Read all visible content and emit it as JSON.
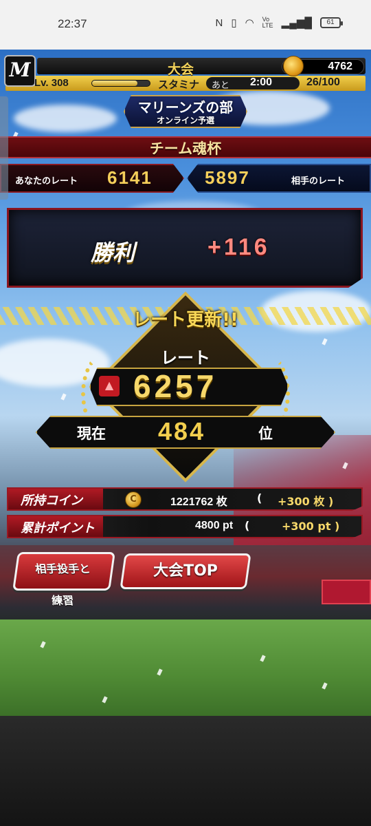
{
  "status_bar": {
    "time": "22:37",
    "nfc": "N",
    "volte": "Vo LTE",
    "battery": "61"
  },
  "header": {
    "menu_logo": "M",
    "title": "大会",
    "currency": "4762",
    "level_label": "Lv.",
    "level_value": "308",
    "level_progress": 0.78,
    "stamina_label": "スタミナ",
    "remaining_label": "あと",
    "timer": "2:00",
    "stamina_value": "26/100"
  },
  "event": {
    "title": "マリーンズの部",
    "subtitle": "オンライン予選",
    "cup_name": "チーム魂杯"
  },
  "rates": {
    "my_label": "あなたのレート",
    "my_value": "6141",
    "opponent_value": "5897",
    "opponent_label": "相手のレート"
  },
  "result": {
    "outcome": "勝利",
    "points": "+116"
  },
  "update": {
    "title": "レート更新!!",
    "rate_label": "レート",
    "rate_value": "6257",
    "rank_prefix": "現在",
    "rank_value": "484",
    "rank_suffix": "位"
  },
  "stats": {
    "coins_label": "所持コイン",
    "coins_value": "1221762 枚",
    "coins_open": "(",
    "coins_add": "+300 枚 )",
    "points_label": "累計ポイント",
    "points_value": "4800 pt",
    "points_open": "(",
    "points_add": "+300 pt )"
  },
  "buttons": {
    "practice_line1": "相手投手と",
    "practice_line2": "練習",
    "top": "大会TOP"
  },
  "icons": {
    "coin_symbol": "C",
    "rate_up_symbol": "▲"
  }
}
